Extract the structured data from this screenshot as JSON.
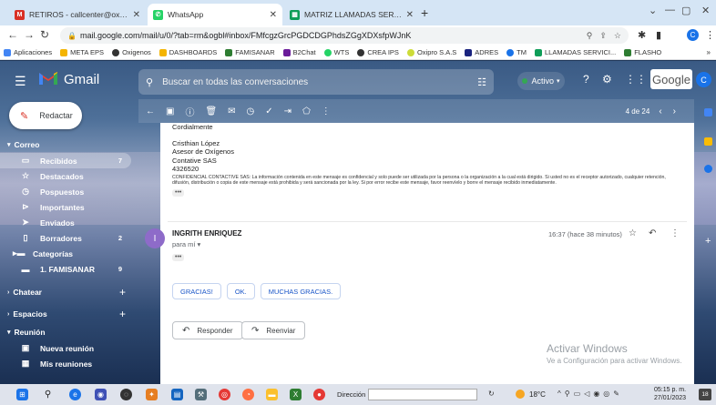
{
  "browser": {
    "tabs": [
      {
        "title": "RETIROS - callcenter@oxiprosas.",
        "active": false,
        "icon": "gmail-icon"
      },
      {
        "title": "WhatsApp",
        "active": true,
        "icon": "whatsapp-icon"
      },
      {
        "title": "MATRIZ LLAMADAS SERVICIO TE",
        "active": false,
        "icon": "sheets-icon"
      }
    ],
    "new_tab": "+",
    "url": "mail.google.com/mail/u/0/?tab=rm&ogbl#inbox/FMfcgzGrcPGDCDGPhdsZGgXDXsfpWJnK",
    "bookmarks": [
      "Aplicaciones",
      "META EPS",
      "Oxigenos",
      "DASHBOARDS",
      "FAMISANAR",
      "B2Chat",
      "WTS",
      "CREA IPS",
      "Oxipro S.A.S",
      "ADRES",
      "TM",
      "LLAMADAS SERVICI...",
      "FLASHO"
    ],
    "bookmarks_more": "»",
    "profile_initial": "C"
  },
  "gmail": {
    "app_name": "Gmail",
    "search_placeholder": "Buscar en todas las conversaciones",
    "status_label": "Activo",
    "google_word": "Google",
    "avatar_initial": "C",
    "compose_label": "Redactar",
    "sections": {
      "mail": "Correo",
      "chat": "Chatear",
      "spaces": "Espacios",
      "meet": "Reunión"
    },
    "mail_items": [
      {
        "label": "Recibidos",
        "count": "7",
        "icon": "inbox-icon",
        "active": true
      },
      {
        "label": "Destacados",
        "count": "",
        "icon": "star-icon",
        "active": false
      },
      {
        "label": "Pospuestos",
        "count": "",
        "icon": "clock-icon",
        "active": false
      },
      {
        "label": "Importantes",
        "count": "",
        "icon": "important-icon",
        "active": false
      },
      {
        "label": "Enviados",
        "count": "",
        "icon": "send-icon",
        "active": false
      },
      {
        "label": "Borradores",
        "count": "2",
        "icon": "draft-icon",
        "active": false
      },
      {
        "label": "Categorías",
        "count": "",
        "icon": "label-icon",
        "active": false
      },
      {
        "label": "1. FAMISANAR",
        "count": "9",
        "icon": "label-icon",
        "active": false
      }
    ],
    "meet_items": [
      {
        "label": "Nueva reunión",
        "icon": "video-icon"
      },
      {
        "label": "Mis reuniones",
        "icon": "calendar-icon"
      }
    ],
    "pagination": "4 de 24"
  },
  "message": {
    "closing": "Cordialmente",
    "signature": [
      "Cristhian López",
      "Asesor de Oxígenos",
      "Contative SAS",
      "4326520"
    ],
    "confidential": "CONFIDENCIAL CONTACTIVE SAS: La información contenida en este mensaje es confidencial y solo puede ser utilizada por la persona o la organización a la cual está dirigido. Si usted no es el receptor autorizado, cualquier retención, difusión, distribución o copia de este mensaje está prohibida y será sancionada por la ley. Si por error recibe este mensaje, favor reenvíelo y borre el mensaje recibido inmediatamente.",
    "ellipsis": "•••",
    "sender": "INGRITH ENRIQUEZ",
    "sender_initial": "I",
    "to": "para mí",
    "time": "16:37 (hace 38 minutos)",
    "smart_replies": [
      "GRACIAS!",
      "OK.",
      "MUCHAS GRACIAS."
    ],
    "reply_label": "Responder",
    "forward_label": "Reenviar"
  },
  "watermark": {
    "line1": "Activar Windows",
    "line2": "Ve a Configuración para activar Windows."
  },
  "taskbar": {
    "search_label": "Dirección",
    "temperature": "18°C",
    "time": "05:15 p. m.",
    "date": "27/01/2023",
    "notifications": "18"
  },
  "colors": {
    "accent": "#1a73e8",
    "gmail_red": "#d93025",
    "avatar_purple": "#8e6bc9",
    "active_green": "#34a853"
  }
}
